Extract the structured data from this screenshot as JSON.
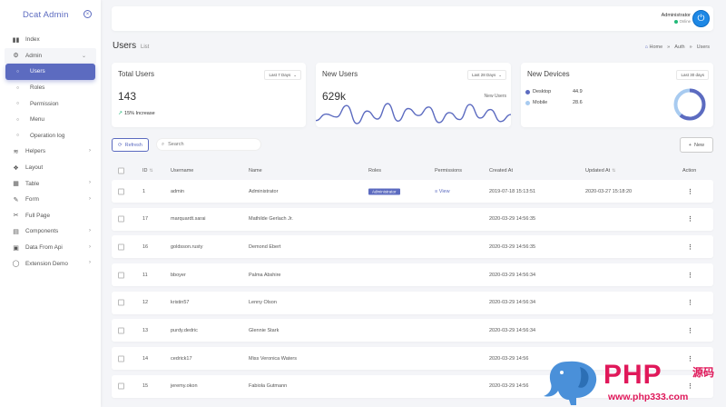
{
  "brand": {
    "title": "Dcat Admin"
  },
  "sidebar": {
    "items": [
      {
        "label": "Index",
        "icon": "bar-chart-icon"
      },
      {
        "label": "Admin",
        "icon": "gear-icon",
        "expanded": true
      },
      {
        "label": "Users",
        "icon": "circle-icon",
        "active": true
      },
      {
        "label": "Roles",
        "icon": "circle-icon"
      },
      {
        "label": "Permission",
        "icon": "circle-icon"
      },
      {
        "label": "Menu",
        "icon": "circle-icon"
      },
      {
        "label": "Operation log",
        "icon": "circle-icon"
      },
      {
        "label": "Helpers",
        "icon": "layers-icon"
      },
      {
        "label": "Layout",
        "icon": "cubes-icon"
      },
      {
        "label": "Table",
        "icon": "table-icon"
      },
      {
        "label": "Form",
        "icon": "edit-icon"
      },
      {
        "label": "Full Page",
        "icon": "scissors-icon"
      },
      {
        "label": "Components",
        "icon": "file-icon"
      },
      {
        "label": "Data From Api",
        "icon": "film-icon"
      },
      {
        "label": "Extension Demo",
        "icon": "circle-outline-icon"
      }
    ]
  },
  "topbar": {
    "user_name": "Administrator",
    "user_status": "Online"
  },
  "page": {
    "title": "Users",
    "subtitle": "List"
  },
  "breadcrumb": {
    "home": "Home",
    "sep": "»",
    "auth": "Auth",
    "users": "Users"
  },
  "cards": {
    "total_users": {
      "title": "Total Users",
      "select": "Last 7 Days",
      "value": "143",
      "increase": "15% Increase"
    },
    "new_users": {
      "title": "New Users",
      "select": "Last 28 Days",
      "value": "629k",
      "chart_label": "New Users",
      "series": [
        28,
        41,
        35,
        58,
        22,
        47,
        31,
        62,
        27,
        52,
        38,
        55,
        24,
        44,
        30,
        60,
        33,
        50,
        26,
        40
      ]
    },
    "new_devices": {
      "title": "New Devices",
      "select": "Last 30 days",
      "legend": [
        {
          "name": "Desktop",
          "value": "44.9",
          "color": "#5c6bc0"
        },
        {
          "name": "Mobile",
          "value": "28.6",
          "color": "#a8cbf0"
        }
      ]
    }
  },
  "toolbar": {
    "refresh": "Refresh",
    "search_placeholder": "Search",
    "new": "New"
  },
  "grid": {
    "headers": {
      "id": "ID",
      "username": "Username",
      "name": "Name",
      "roles": "Roles",
      "permissions": "Permissions",
      "created": "Created At",
      "updated": "Updated At",
      "action": "Action"
    },
    "rows": [
      {
        "id": "1",
        "username": "admin",
        "name": "Administrator",
        "role": "Administrator",
        "permission": "View",
        "created": "2019-07-18 15:13:51",
        "updated": "2020-03-27 15:18:20"
      },
      {
        "id": "17",
        "username": "marquardt.sarai",
        "name": "Mathilde Gerlach Jr.",
        "role": "",
        "permission": "",
        "created": "2020-03-29 14:56:35",
        "updated": ""
      },
      {
        "id": "16",
        "username": "goldsson.rusty",
        "name": "Demond Ebert",
        "role": "",
        "permission": "",
        "created": "2020-03-29 14:56:35",
        "updated": ""
      },
      {
        "id": "11",
        "username": "bboyer",
        "name": "Palma Abshire",
        "role": "",
        "permission": "",
        "created": "2020-03-29 14:56:34",
        "updated": ""
      },
      {
        "id": "12",
        "username": "kristin57",
        "name": "Lenny Olson",
        "role": "",
        "permission": "",
        "created": "2020-03-29 14:56:34",
        "updated": ""
      },
      {
        "id": "13",
        "username": "purdy.dedric",
        "name": "Glennie Stark",
        "role": "",
        "permission": "",
        "created": "2020-03-29 14:56:34",
        "updated": ""
      },
      {
        "id": "14",
        "username": "cedrick17",
        "name": "Miss Veronica Waters",
        "role": "",
        "permission": "",
        "created": "2020-03-29 14:56",
        "updated": ""
      },
      {
        "id": "15",
        "username": "jeremy.okon",
        "name": "Fabiola Gutmann",
        "role": "",
        "permission": "",
        "created": "2020-03-29 14:56",
        "updated": ""
      }
    ]
  },
  "watermark": {
    "text": "PHP",
    "cn": "源码",
    "url": "www.php333.com"
  }
}
